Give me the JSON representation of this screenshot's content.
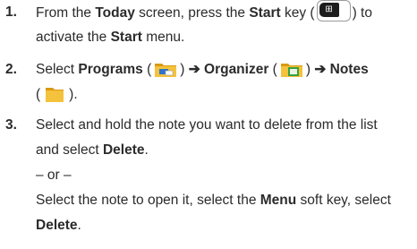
{
  "steps": [
    {
      "number": "1.",
      "line1": {
        "a": "From the ",
        "b1": "Today",
        "c": " screen, press the ",
        "b2": "Start",
        "d": " key (",
        "e": ") to"
      },
      "line2": {
        "a": "activate the ",
        "b": "Start",
        "c": " menu."
      }
    },
    {
      "number": "2.",
      "line1": {
        "a": "Select ",
        "b1": "Programs",
        "c": " (",
        "d": ") ",
        "arrow1": "➔",
        "b2": " Organizer",
        "e": " (",
        "f": ") ",
        "arrow2": "➔",
        "b3": " Notes"
      },
      "line2": {
        "a": "(",
        "b": ")."
      }
    },
    {
      "number": "3.",
      "line1": "Select and hold the note you want to delete from the list",
      "line2": {
        "a": "and select ",
        "b": "Delete",
        "c": "."
      },
      "or": "– or –",
      "line3": {
        "a": "Select the note to open it, select the ",
        "b": "Menu",
        "c": " soft key, select"
      },
      "line4": {
        "b": "Delete",
        "c": "."
      }
    }
  ],
  "icons": {
    "start_key": "windows-start-key-icon",
    "programs": "programs-folder-icon",
    "organizer": "organizer-folder-icon",
    "notes": "notes-folder-icon"
  },
  "colors": {
    "text": "#2b2b2b",
    "folder": "#f4c23c",
    "folder_dark": "#d99a12",
    "accent_green": "#3aa03c",
    "accent_blue": "#2f74c8"
  }
}
